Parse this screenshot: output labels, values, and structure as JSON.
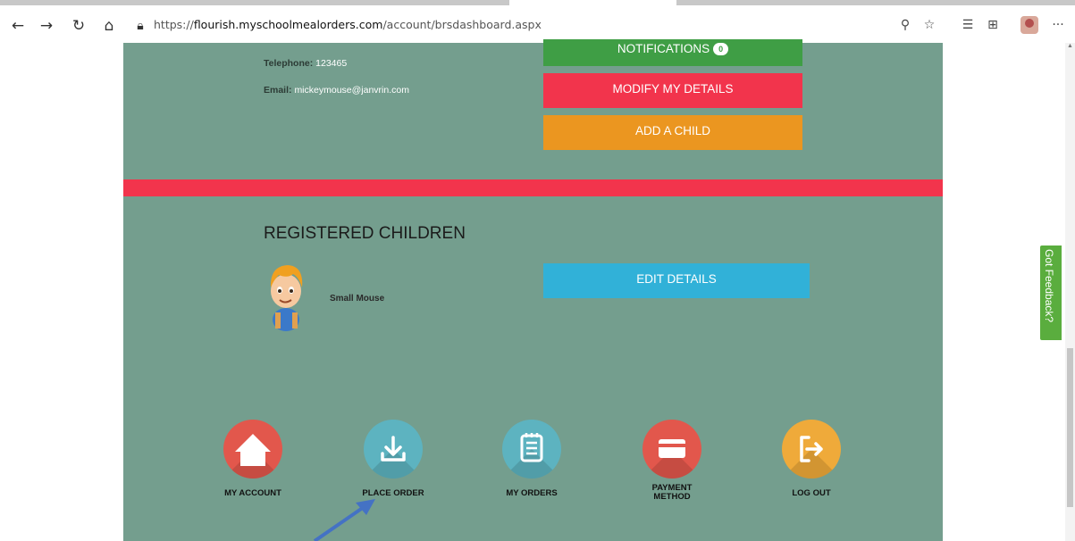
{
  "browser": {
    "url_prefix": "https://",
    "url_host": "flourish.myschoolmealorders.com",
    "url_path": "/account/brsdashboard.aspx",
    "more_label": "···"
  },
  "contact": {
    "telephone_label": "Telephone:",
    "telephone_value": "123465",
    "email_label": "Email:",
    "email_value": "mickeymouse@janvrin.com"
  },
  "actions": {
    "notifications_label": "NOTIFICATIONS",
    "notifications_count": "0",
    "modify_label": "MODIFY MY DETAILS",
    "add_child_label": "ADD A CHILD"
  },
  "children": {
    "title": "REGISTERED CHILDREN",
    "items": [
      {
        "name": "Small Mouse",
        "edit_label": "EDIT DETAILS"
      }
    ]
  },
  "bottom_nav": [
    {
      "label": "MY ACCOUNT",
      "icon": "house-icon",
      "color": "#e2574c"
    },
    {
      "label": "PLACE ORDER",
      "icon": "download-icon",
      "color": "#5db3c0"
    },
    {
      "label": "MY ORDERS",
      "icon": "notepad-icon",
      "color": "#5db3c0"
    },
    {
      "label": "PAYMENT",
      "label2": "METHOD",
      "icon": "credit-card-icon",
      "color": "#e2574c"
    },
    {
      "label": "LOG OUT",
      "icon": "logout-icon",
      "color": "#efaa3a"
    }
  ],
  "feedback": {
    "label": "Got Feedback?"
  },
  "colors": {
    "page_bg": "#749e8e",
    "green": "#3f9e45",
    "red": "#f2344c",
    "orange": "#eb9620",
    "blue": "#31b1d8",
    "arrow": "#4472c4"
  }
}
